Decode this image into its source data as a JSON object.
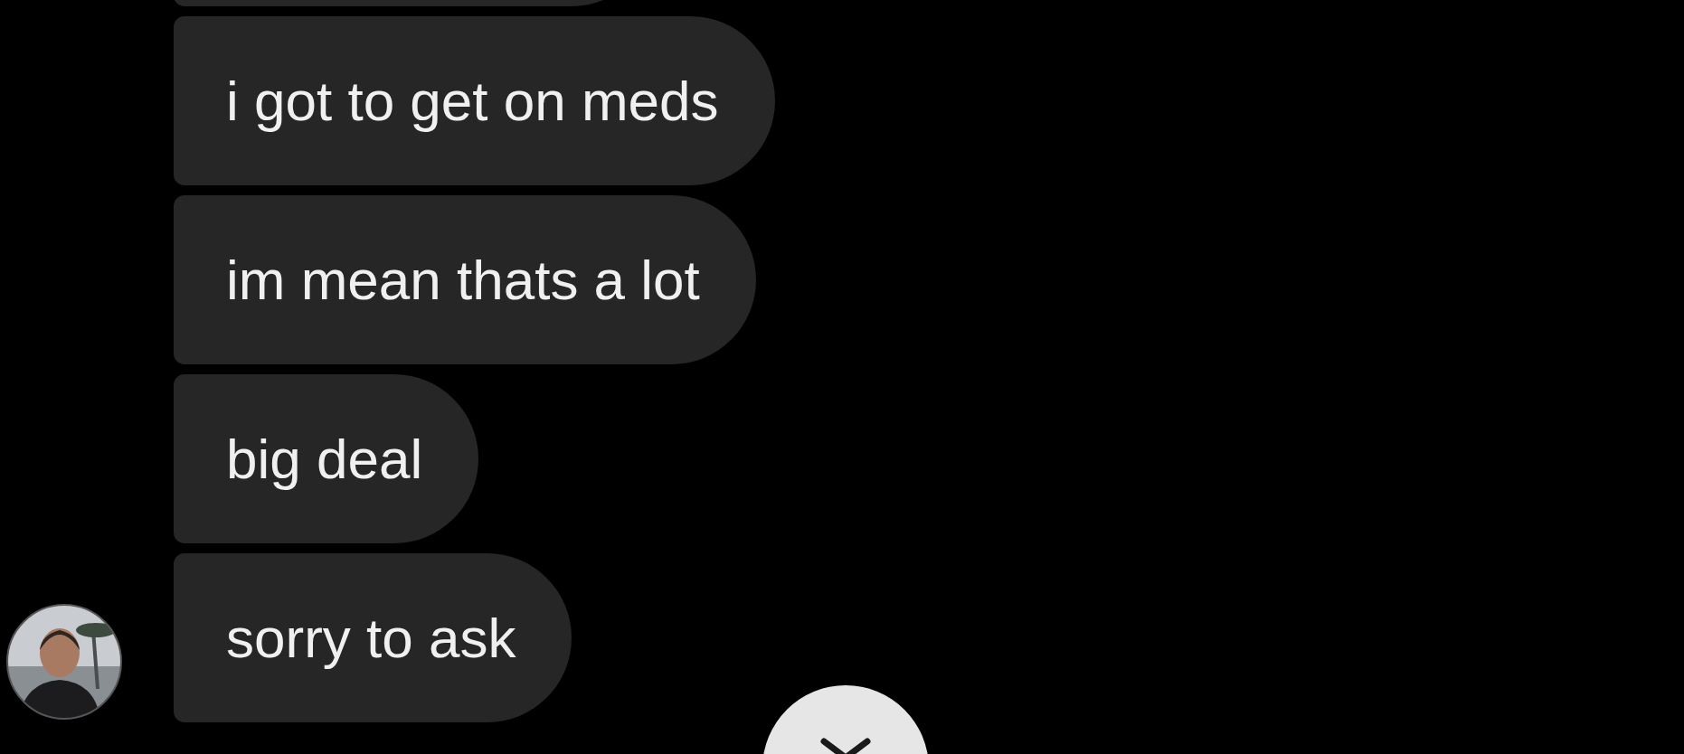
{
  "messages": [
    {
      "text": "i got to get on meds"
    },
    {
      "text": "im mean thats a lot"
    },
    {
      "text": "big deal"
    },
    {
      "text": "sorry to ask"
    }
  ]
}
